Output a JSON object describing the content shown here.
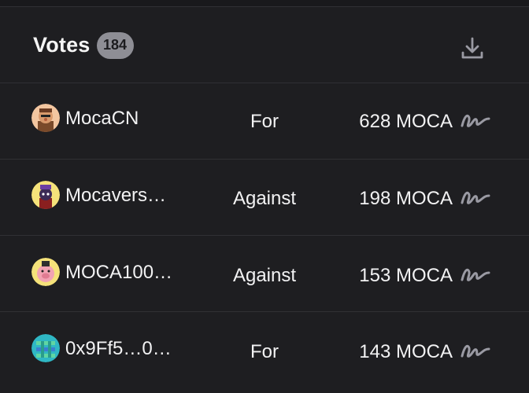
{
  "header": {
    "title": "Votes",
    "count": "184"
  },
  "votes": [
    {
      "voter": "MocaCN",
      "choice": "For",
      "amount": "628 MOCA",
      "avatar_icon": "moca-avatar-orange"
    },
    {
      "voter": "Mocavers…",
      "choice": "Against",
      "amount": "198 MOCA",
      "avatar_icon": "moca-avatar-yellow"
    },
    {
      "voter": "MOCA100…",
      "choice": "Against",
      "amount": "153 MOCA",
      "avatar_icon": "moca-avatar-pink"
    },
    {
      "voter": "0x9Ff5…0…",
      "choice": "For",
      "amount": "143 MOCA",
      "avatar_icon": "moca-avatar-teal"
    }
  ],
  "colors": {
    "background": "#1e1e21",
    "divider": "#303034",
    "badge": "#8e8e95",
    "icon": "#9a9aa3"
  }
}
